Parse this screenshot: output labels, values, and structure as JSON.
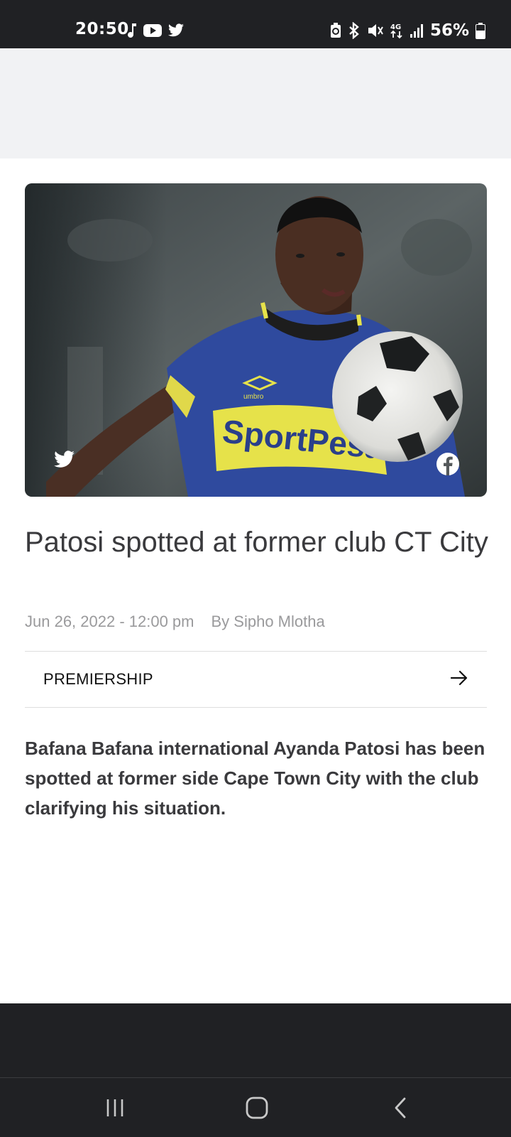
{
  "status_bar": {
    "time": "20:50",
    "left_icons": [
      "music-note-icon",
      "youtube-icon",
      "twitter-icon"
    ],
    "right_icons": [
      "battery-saver-icon",
      "bluetooth-icon",
      "mute-icon",
      "4g-data-icon",
      "signal-icon"
    ],
    "battery": "56%"
  },
  "article": {
    "headline": "Patosi spotted at former club CT City",
    "date": "Jun 26, 2022 - 12:00 pm",
    "author": "By Sipho Mlotha",
    "category": "PREMIERSHIP",
    "intro": "Bafana Bafana international Ayanda Patosi has been spotted at former side Cape Town City with the club clarifying his situation."
  },
  "hero": {
    "share_icons": [
      "twitter-icon",
      "facebook-icon"
    ],
    "jersey_text": "SportPesa",
    "jersey_brand": "umbro"
  },
  "nav_bar": {
    "buttons": [
      "recent-apps-icon",
      "home-icon",
      "back-icon"
    ]
  },
  "colors": {
    "status_bar_bg": "#202124",
    "ad_bg": "#f1f2f4",
    "headline": "#3a3a3d",
    "meta": "#9a9a9c"
  }
}
